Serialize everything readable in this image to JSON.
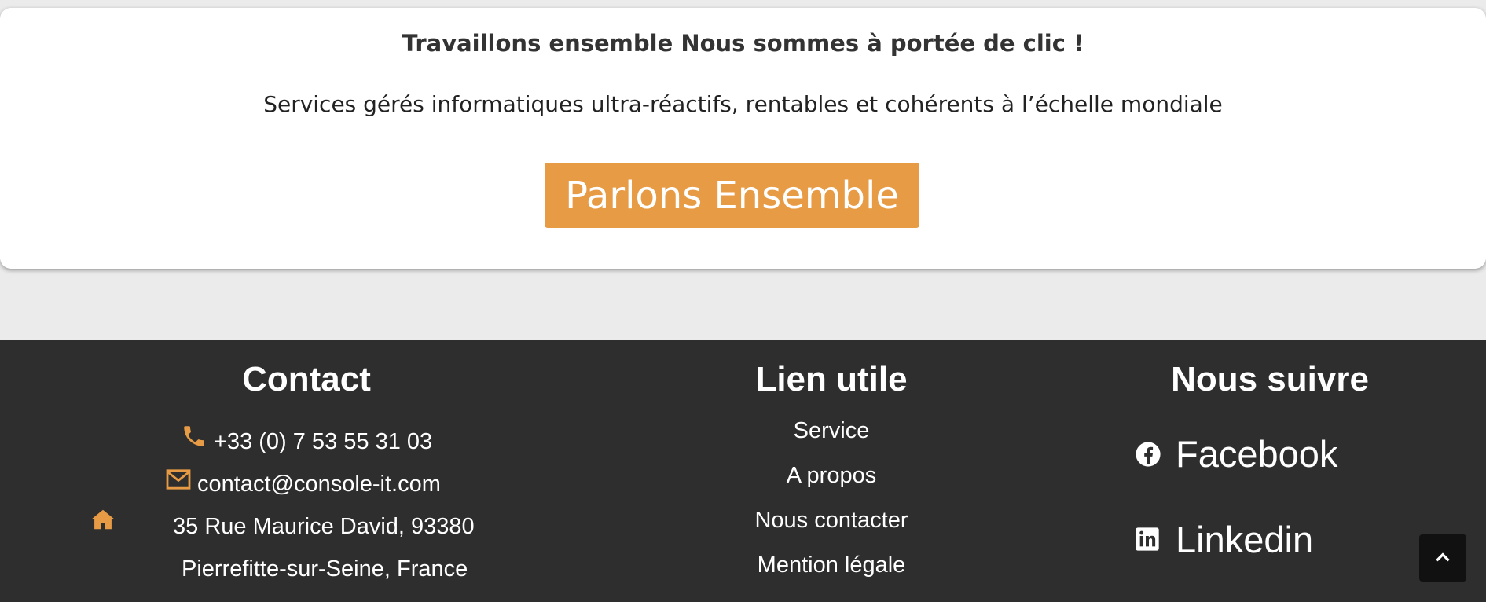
{
  "cta": {
    "title": "Travaillons ensemble Nous sommes à portée de clic !",
    "subtitle": "Services gérés informatiques ultra-réactifs, rentables et cohérents à l’échelle mondiale",
    "button_label": "Parlons Ensemble",
    "button_color": "#e89b45"
  },
  "footer": {
    "background": "#2e2e2e",
    "contact": {
      "title": "Contact",
      "phone": "+33 (0) 7 53 55 31 03",
      "email": "contact@console-it.com",
      "address_line1": "35 Rue Maurice David, 93380",
      "address_line2": "Pierrefitte-sur-Seine, France",
      "icons": [
        "phone-icon",
        "envelope-icon",
        "home-icon"
      ]
    },
    "links": {
      "title": "Lien utile",
      "items": [
        "Service",
        "A propos",
        "Nous contacter",
        "Mention légale"
      ]
    },
    "social": {
      "title": "Nous suivre",
      "items": [
        {
          "label": "Facebook",
          "icon": "facebook-icon"
        },
        {
          "label": "Linkedin",
          "icon": "linkedin-icon"
        }
      ]
    }
  },
  "back_to_top_icon": "chevron-up-icon"
}
